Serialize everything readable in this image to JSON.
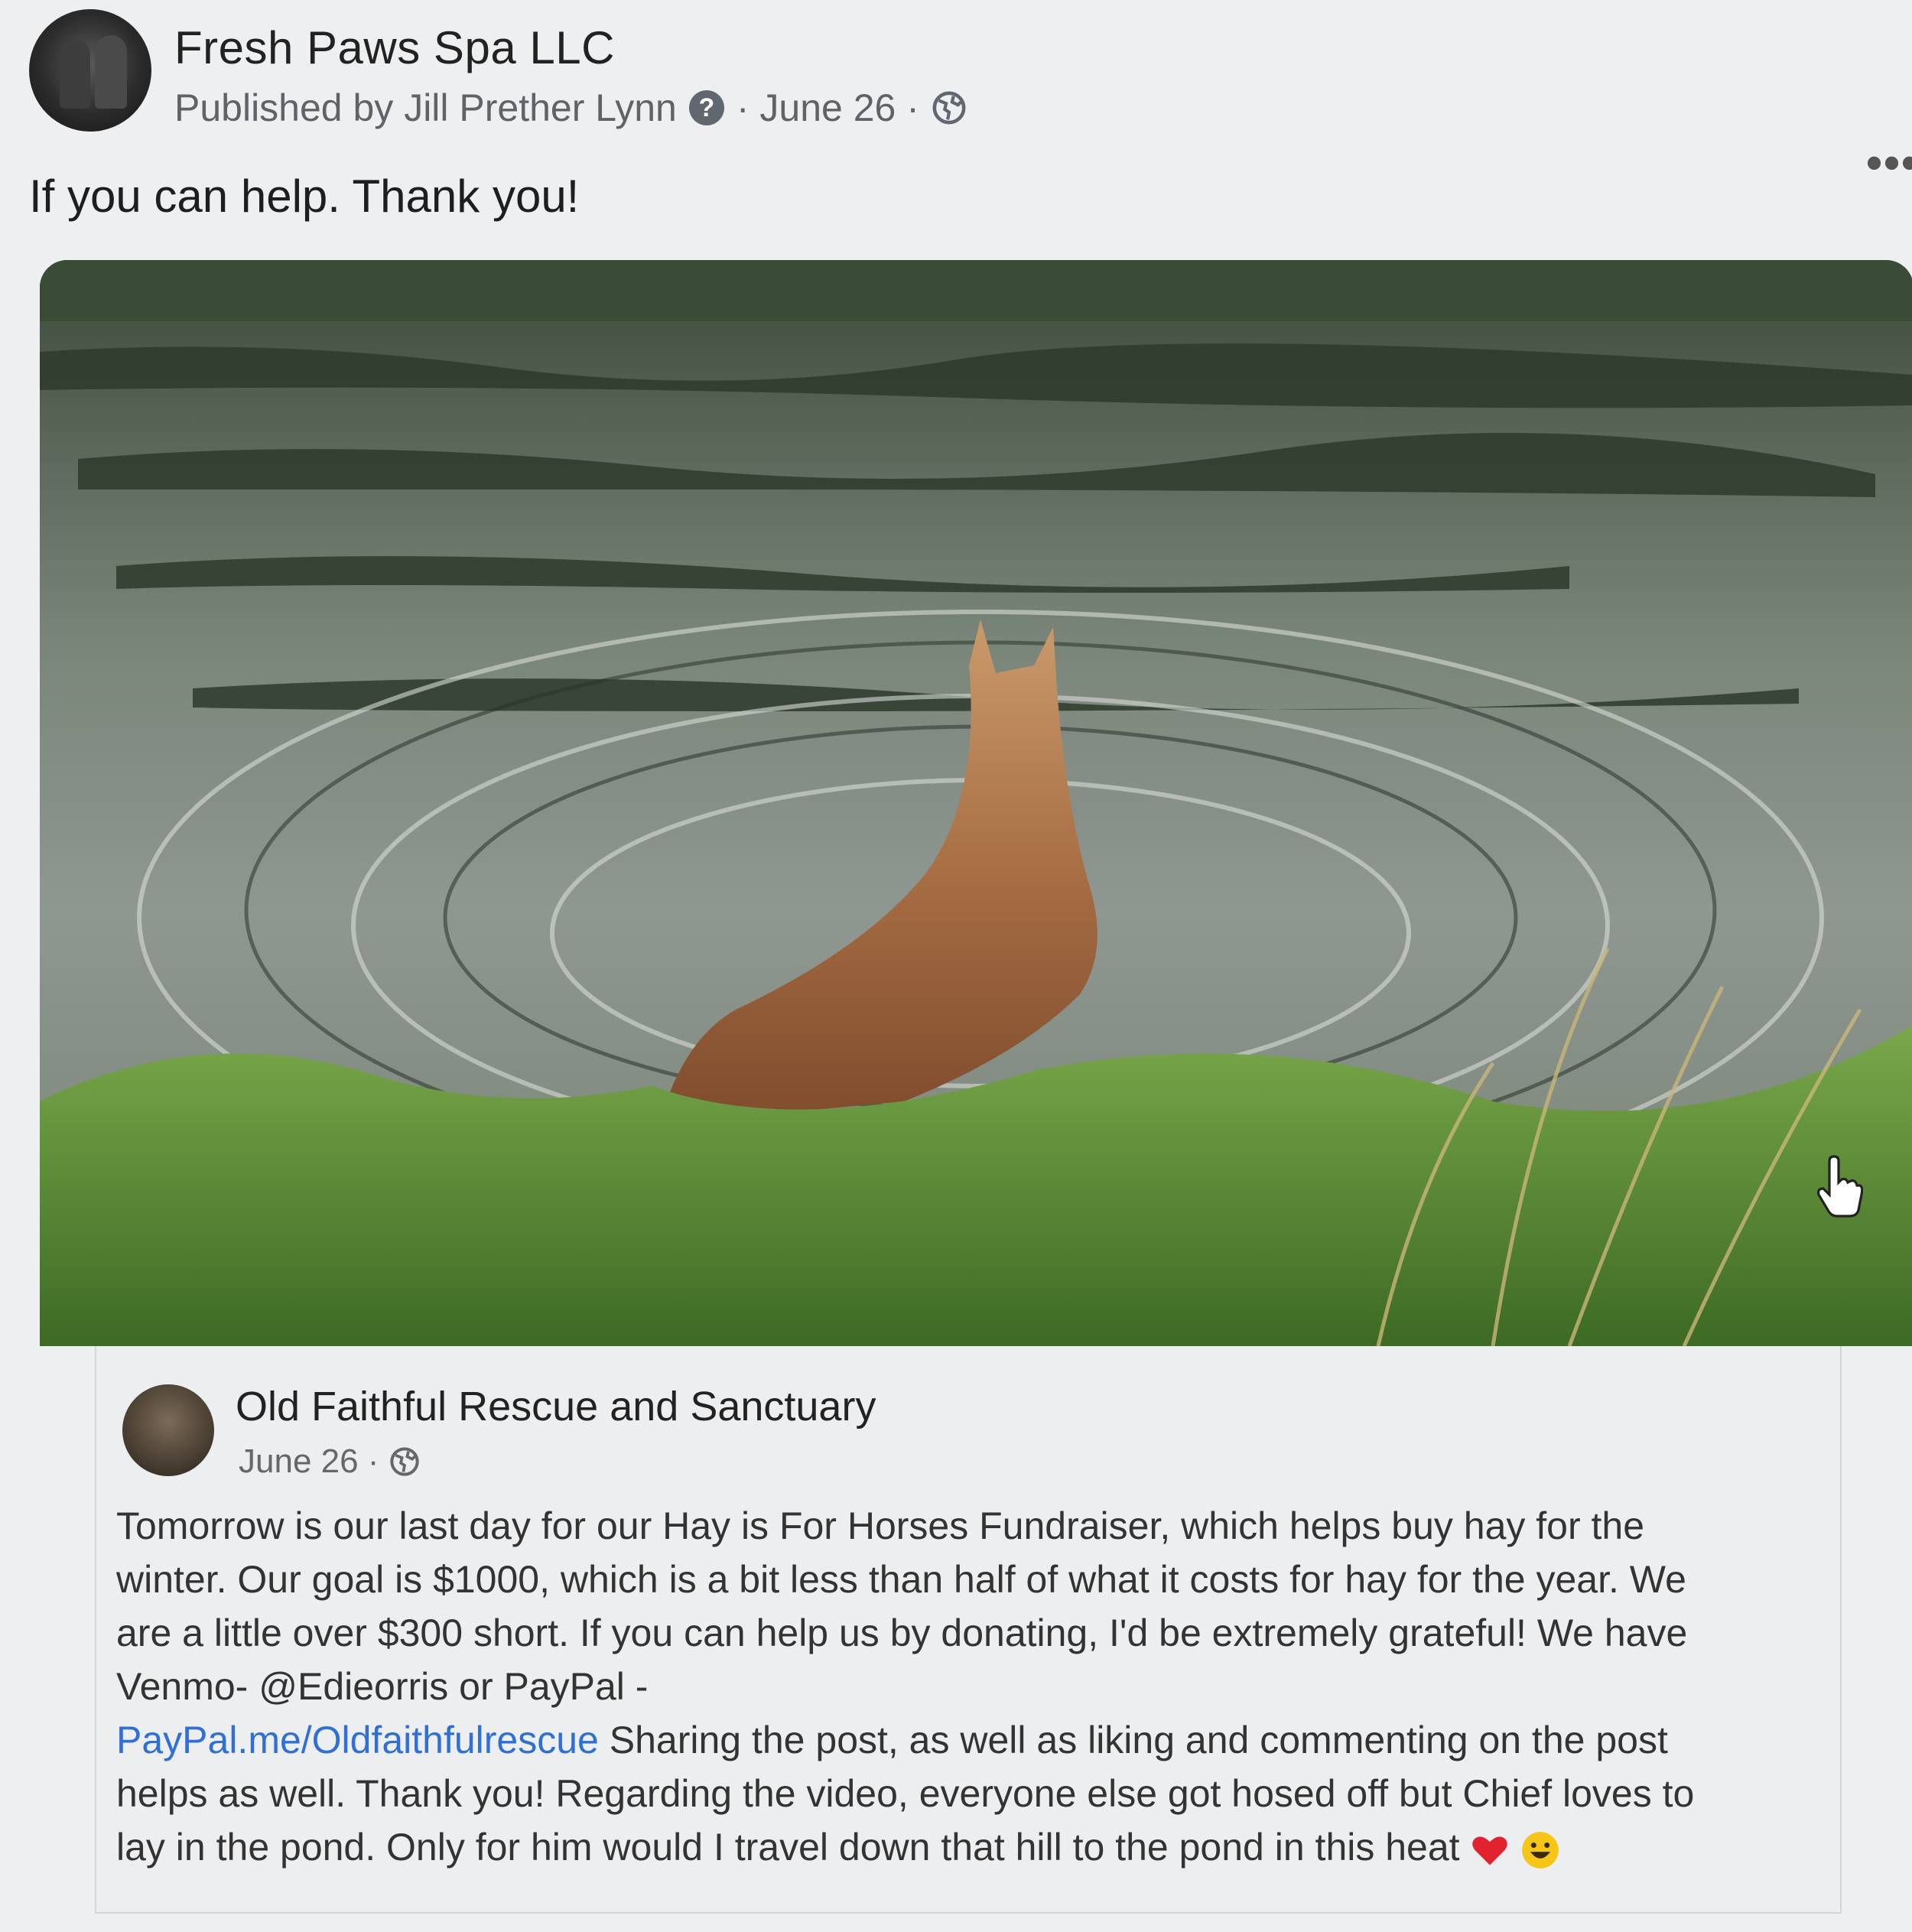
{
  "post": {
    "page_name": "Fresh Paws Spa LLC",
    "published_by": "Published by Jill Prether Lynn",
    "date": "· June 26 ·",
    "caption": "If you can help. Thank you!",
    "more_label": "•••"
  },
  "shared": {
    "name": "Old Faithful Rescue and Sanctuary",
    "date": "June 26 ·",
    "lines": [
      "Tomorrow is our last day for our Hay is For Horses Fundraiser, which helps buy hay for the",
      "winter. Our goal is $1000, which is a bit less than half of what it costs for hay for the year. We",
      "are a little over $300 short. If you can help us by donating, I'd be extremely grateful! We have",
      "Venmo- @Edieorris or PayPal -"
    ],
    "link": "PayPal.me/Oldfaithfulrescue",
    "after_link": " Sharing the post, as well as liking and commenting on the post",
    "line6": "helps as well. Thank you! Regarding the video, everyone else got hosed off but Chief loves to",
    "line7": "lay in the pond. Only for him would I travel down that hill to the pond in this heat"
  },
  "colors": {
    "link": "#2f6fd6",
    "heart": "#e0232e",
    "emoji": "#f5c518"
  },
  "icons": [
    "question-icon",
    "globe-icon",
    "more-options-icon",
    "cursor-hand-icon",
    "volume-muted-icon",
    "heart-emoji-icon",
    "smile-emoji-icon"
  ]
}
